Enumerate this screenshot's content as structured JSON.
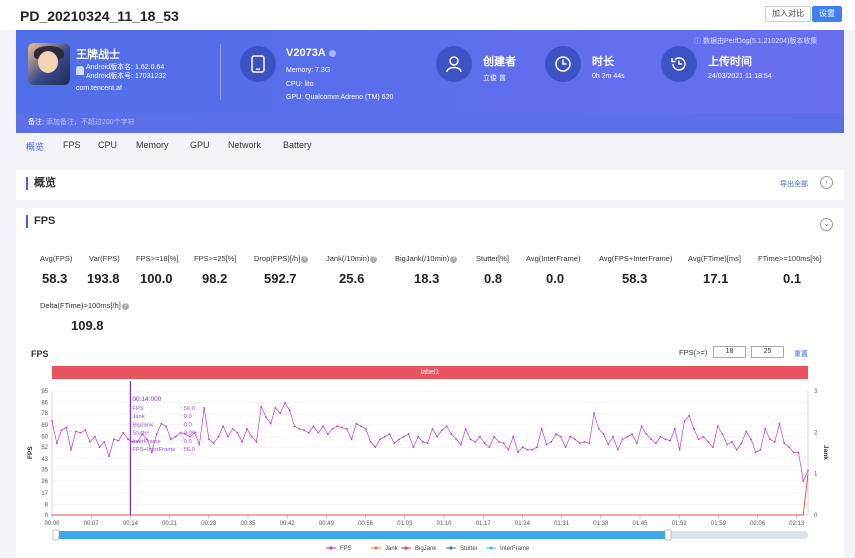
{
  "header": {
    "title": "PD_20210324_11_18_53",
    "compare_label": "加入对比",
    "settings_label": "设置"
  },
  "app": {
    "name": "王牌战士",
    "android_version": "Android版本名: 1.62.0.64",
    "android_code": "Android版本号: 17031232",
    "package": "com.tencent.af"
  },
  "device": {
    "name": "V2073A",
    "memory": "Memory: 7.3G",
    "cpu": "CPU: lito",
    "gpu": "GPU: Qualcomm Adreno (TM) 620"
  },
  "creator": {
    "label": "创建者",
    "value": "立俊 曾"
  },
  "duration": {
    "label": "时长",
    "value": "0h 2m 44s"
  },
  "upload": {
    "label": "上传时间",
    "value": "24/03/2021 11:18:54"
  },
  "data_source_note": "数据由PerfDog(5.1.210204)版本收集",
  "note": {
    "label": "备注:",
    "placeholder": "添加备注，不超过200个字符"
  },
  "tabs": [
    "概览",
    "FPS",
    "CPU",
    "Memory",
    "GPU",
    "Network",
    "Battery"
  ],
  "overview": {
    "title": "概览",
    "export_label": "导出全部"
  },
  "fps_section": {
    "title": "FPS",
    "metrics": [
      {
        "label": "Avg(FPS)",
        "value": "58.3",
        "help": false
      },
      {
        "label": "Var(FPS)",
        "value": "193.8",
        "help": false
      },
      {
        "label": "FPS>=18[%]",
        "value": "100.0",
        "help": false
      },
      {
        "label": "FPS>=25[%]",
        "value": "98.2",
        "help": false
      },
      {
        "label": "Drop(FPS)[/h]",
        "value": "592.7",
        "help": true
      },
      {
        "label": "Jank(/10min)",
        "value": "25.6",
        "help": true
      },
      {
        "label": "BigJank(/10min)",
        "value": "18.3",
        "help": true
      },
      {
        "label": "Stutter[%]",
        "value": "0.8",
        "help": false
      },
      {
        "label": "Avg(InterFrame)",
        "value": "0.0",
        "help": false
      },
      {
        "label": "Avg(FPS+InterFrame)",
        "value": "58.3",
        "help": false
      },
      {
        "label": "Avg(FTime)[ms]",
        "value": "17.1",
        "help": false
      },
      {
        "label": "FTime>=100ms[%]",
        "value": "0.1",
        "help": false
      },
      {
        "label": "Delta(FTime)>100ms[/h]",
        "value": "109.8",
        "help": true
      }
    ],
    "fps_threshold_label": "FPS(>=)",
    "fps_threshold_1": "18",
    "fps_threshold_2": "25",
    "reset_label": "重置",
    "band_label": "label1"
  },
  "colors": {
    "accent": "#3f63e0",
    "fps": "#c23ad0",
    "jank": "#ee7d3a",
    "bigjank": "#e03a3a",
    "stutter": "#4a6fa5",
    "interframe": "#3cc6b4"
  },
  "chart_data": {
    "type": "line",
    "title": "FPS",
    "ylabel": "FPS",
    "y2label": "Jank",
    "ylim": [
      0,
      95
    ],
    "y2lim": [
      0,
      3
    ],
    "yticks": [
      0,
      8,
      17,
      26,
      35,
      43,
      52,
      60,
      69,
      78,
      86,
      95
    ],
    "y2ticks": [
      0,
      1,
      2,
      3
    ],
    "xlim": [
      0,
      135
    ],
    "xticks": [
      "00:00",
      "00:07",
      "00:14",
      "00:21",
      "00:28",
      "00:35",
      "00:42",
      "00:49",
      "00:56",
      "01:03",
      "01:10",
      "01:17",
      "01:24",
      "01:31",
      "01:38",
      "01:45",
      "01:52",
      "01:59",
      "02:06",
      "02:13"
    ],
    "legend": [
      "FPS",
      "Jank",
      "BigJank",
      "Stutter",
      "InterFrame"
    ],
    "legend_position": "bottom",
    "series": [
      {
        "name": "FPS",
        "values": [
          72,
          55,
          65,
          67,
          50,
          64,
          63,
          65,
          56,
          60,
          52,
          56,
          45,
          58,
          57,
          63,
          58,
          56,
          56,
          62,
          58,
          48,
          62,
          70,
          68,
          58,
          60,
          63,
          62,
          60,
          63,
          54,
          82,
          58,
          55,
          60,
          68,
          60,
          66,
          63,
          56,
          66,
          60,
          56,
          83,
          75,
          70,
          82,
          78,
          86,
          80,
          68,
          66,
          65,
          63,
          68,
          63,
          68,
          62,
          66,
          68,
          67,
          66,
          58,
          70,
          68,
          66,
          56,
          52,
          58,
          60,
          62,
          55,
          58,
          60,
          62,
          52,
          60,
          56,
          55,
          66,
          60,
          65,
          68,
          62,
          58,
          54,
          66,
          58,
          56,
          60,
          55,
          52,
          60,
          56,
          55,
          50,
          60,
          48,
          52,
          50,
          50,
          52,
          66,
          54,
          56,
          62,
          60,
          52,
          60,
          58,
          55,
          56,
          55,
          78,
          66,
          62,
          54,
          60,
          50,
          58,
          60,
          62,
          55,
          68,
          62,
          58,
          55,
          60,
          58,
          57,
          66,
          50,
          72,
          76,
          66,
          58,
          60,
          56,
          52,
          68,
          62,
          54,
          56,
          50,
          55,
          64,
          58,
          48,
          50,
          66,
          58,
          56,
          70,
          55,
          52,
          48,
          48,
          26,
          34
        ]
      },
      {
        "name": "Jank",
        "values": [
          0,
          0,
          0,
          0,
          0,
          0,
          0,
          0,
          0,
          0,
          0,
          0,
          0,
          0,
          0,
          0,
          0,
          0,
          0,
          0,
          0,
          0,
          0,
          0,
          0,
          0,
          0,
          0,
          0,
          0,
          0,
          0,
          0,
          0,
          0,
          0,
          0,
          0,
          0,
          0,
          0,
          0,
          0,
          0,
          0,
          0,
          0,
          0,
          0,
          0,
          0,
          0,
          0,
          0,
          0,
          0,
          0,
          0,
          0,
          0,
          0,
          0,
          0,
          0,
          0,
          0,
          0,
          0,
          0,
          0,
          0,
          0,
          0,
          0,
          0,
          0,
          0,
          0,
          0,
          0,
          0,
          0,
          0,
          0,
          0,
          0,
          0,
          0,
          0,
          0,
          0,
          0,
          0,
          0,
          0,
          0,
          0,
          0,
          0,
          0,
          0,
          0,
          0,
          0,
          0,
          0,
          0,
          0,
          0,
          0,
          0,
          0,
          0,
          0,
          0,
          0,
          0,
          0,
          0,
          0,
          0,
          0,
          0,
          0,
          0,
          0,
          0,
          0,
          0,
          0,
          0,
          0,
          0,
          0,
          0,
          0,
          0,
          0,
          0,
          0,
          0,
          0,
          0,
          0,
          0,
          0,
          0,
          0,
          0,
          0,
          0,
          0,
          0,
          0,
          0,
          0,
          0,
          0,
          0,
          1
        ]
      },
      {
        "name": "BigJank",
        "values": [
          0,
          0,
          0,
          0,
          0,
          0,
          0,
          0,
          0,
          0,
          0,
          0,
          0,
          0,
          0,
          0,
          0,
          0,
          0,
          0,
          0,
          0,
          0,
          0,
          0,
          0,
          0,
          0,
          0,
          0,
          0,
          0,
          0,
          0,
          0,
          0,
          0,
          0,
          0,
          0,
          0,
          0,
          0,
          0,
          0,
          0,
          0,
          0,
          0,
          0,
          0,
          0,
          0,
          0,
          0,
          0,
          0,
          0,
          0,
          0,
          0,
          0,
          0,
          0,
          0,
          0,
          0,
          0,
          0,
          0,
          0,
          0,
          0,
          0,
          0,
          0,
          0,
          0,
          0,
          0,
          0,
          0,
          0,
          0,
          0,
          0,
          0,
          0,
          0,
          0,
          0,
          0,
          0,
          0,
          0,
          0,
          0,
          0,
          0,
          0,
          0,
          0,
          0,
          0,
          0,
          0,
          0,
          0,
          0,
          0,
          0,
          0,
          0,
          0,
          0,
          0,
          0,
          0,
          0,
          0,
          0,
          0,
          0,
          0,
          0,
          0,
          0,
          0,
          0,
          0,
          0,
          0,
          0,
          0,
          0,
          0,
          0,
          0,
          0,
          0,
          0,
          0,
          0,
          0,
          0,
          0,
          0,
          0,
          0,
          0,
          0,
          0,
          0,
          0,
          0,
          0,
          0,
          0,
          0,
          1
        ]
      }
    ],
    "cursor": {
      "time": "00:14:000",
      "rows": [
        {
          "label": "FPS",
          "value": ": 56.0"
        },
        {
          "label": "Jank",
          "value": ": 0.0"
        },
        {
          "label": "BigJank",
          "value": ": 0.0"
        },
        {
          "label": "Stutter",
          "value": ": 0.0%"
        },
        {
          "label": "InterFrame",
          "value": ": 0.0"
        },
        {
          "label": "FPS+InterFrame",
          "value": ": 56.0"
        }
      ]
    },
    "range_selection": [
      0,
      1
    ]
  }
}
